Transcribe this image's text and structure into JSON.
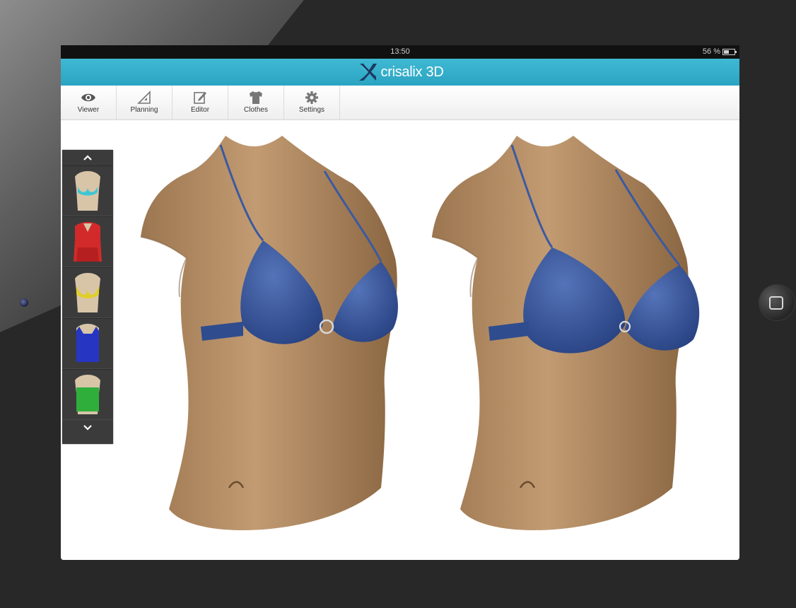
{
  "status_bar": {
    "time": "13:50",
    "battery": "56 %"
  },
  "app": {
    "name": "crisalix 3D",
    "accent_color": "#2aa4c1"
  },
  "toolbar": {
    "items": [
      {
        "label": "Viewer",
        "icon": "eye-icon"
      },
      {
        "label": "Planning",
        "icon": "set-square-icon"
      },
      {
        "label": "Editor",
        "icon": "edit-icon"
      },
      {
        "label": "Clothes",
        "icon": "tshirt-icon"
      },
      {
        "label": "Settings",
        "icon": "gear-icon"
      }
    ]
  },
  "clothes_carousel": {
    "items": [
      {
        "name": "cyan-bikini-top",
        "color": "#3cc7d4"
      },
      {
        "name": "red-blouse",
        "color": "#d22a2a"
      },
      {
        "name": "yellow-bikini-top",
        "color": "#e0cf2a"
      },
      {
        "name": "blue-tank-top",
        "color": "#2636c2"
      },
      {
        "name": "green-tube-top",
        "color": "#2fae3c"
      }
    ]
  },
  "models": [
    {
      "name": "torso-before",
      "bra_color": "#3b5aa0"
    },
    {
      "name": "torso-after",
      "bra_color": "#3b5aa0"
    }
  ]
}
